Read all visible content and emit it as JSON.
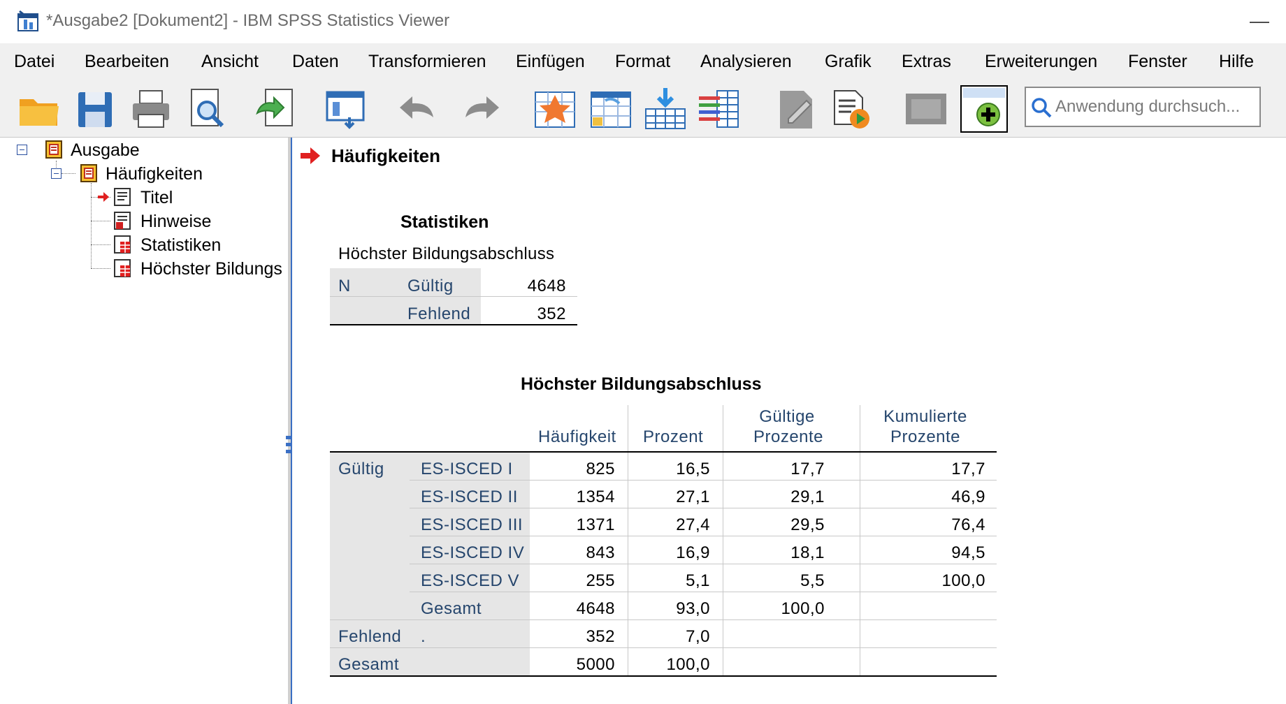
{
  "window": {
    "title": "*Ausgabe2 [Dokument2] - IBM SPSS Statistics Viewer",
    "minimize_symbol": "—"
  },
  "menu": {
    "items": [
      "Datei",
      "Bearbeiten",
      "Ansicht",
      "Daten",
      "Transformieren",
      "Einfügen",
      "Format",
      "Analysieren",
      "Grafik",
      "Extras",
      "Erweiterungen",
      "Fenster",
      "Hilfe"
    ]
  },
  "toolbar": {
    "icons": [
      "open-folder-icon",
      "save-icon",
      "print-icon",
      "print-preview-icon",
      "export-icon",
      "recall-dialog-icon",
      "undo-icon",
      "redo-icon",
      "goto-case-icon",
      "goto-variable-icon",
      "goto-data-icon",
      "variables-icon",
      "edit-output-icon",
      "run-script-icon",
      "show-output-icon",
      "insert-new-icon"
    ],
    "search_placeholder": "Anwendung durchsuch..."
  },
  "tree": {
    "root": "Ausgabe",
    "child": "Häufigkeiten",
    "leaves": [
      "Titel",
      "Hinweise",
      "Statistiken",
      "Höchster Bildungs"
    ]
  },
  "content": {
    "heading": "Häufigkeiten",
    "statistiken": {
      "title": "Statistiken",
      "subtitle": "Höchster Bildungsabschluss",
      "row_group": "N",
      "rows": [
        {
          "label": "Gültig",
          "value": "4648"
        },
        {
          "label": "Fehlend",
          "value": "352"
        }
      ]
    },
    "freq_table": {
      "title": "Höchster Bildungsabschluss",
      "headers": {
        "haeufigkeit": "Häufigkeit",
        "prozent": "Prozent",
        "gueltige_1": "Gültige",
        "gueltige_2": "Prozente",
        "kumulierte_1": "Kumulierte",
        "kumulierte_2": "Prozente"
      },
      "groups": {
        "gueltig": "Gültig",
        "fehlend": "Fehlend",
        "fehlend_sub": ".",
        "gesamt": "Gesamt"
      },
      "rows": [
        {
          "label": "ES-ISCED I",
          "freq": "825",
          "pct": "16,5",
          "valid": "17,7",
          "cum": "17,7"
        },
        {
          "label": "ES-ISCED II",
          "freq": "1354",
          "pct": "27,1",
          "valid": "29,1",
          "cum": "46,9"
        },
        {
          "label": "ES-ISCED III",
          "freq": "1371",
          "pct": "27,4",
          "valid": "29,5",
          "cum": "76,4"
        },
        {
          "label": "ES-ISCED IV",
          "freq": "843",
          "pct": "16,9",
          "valid": "18,1",
          "cum": "94,5"
        },
        {
          "label": "ES-ISCED V",
          "freq": "255",
          "pct": "5,1",
          "valid": "5,5",
          "cum": "100,0"
        },
        {
          "label": "Gesamt",
          "freq": "4648",
          "pct": "93,0",
          "valid": "100,0",
          "cum": ""
        }
      ],
      "fehlend_row": {
        "freq": "352",
        "pct": "7,0"
      },
      "gesamt_row": {
        "freq": "5000",
        "pct": "100,0"
      }
    }
  }
}
